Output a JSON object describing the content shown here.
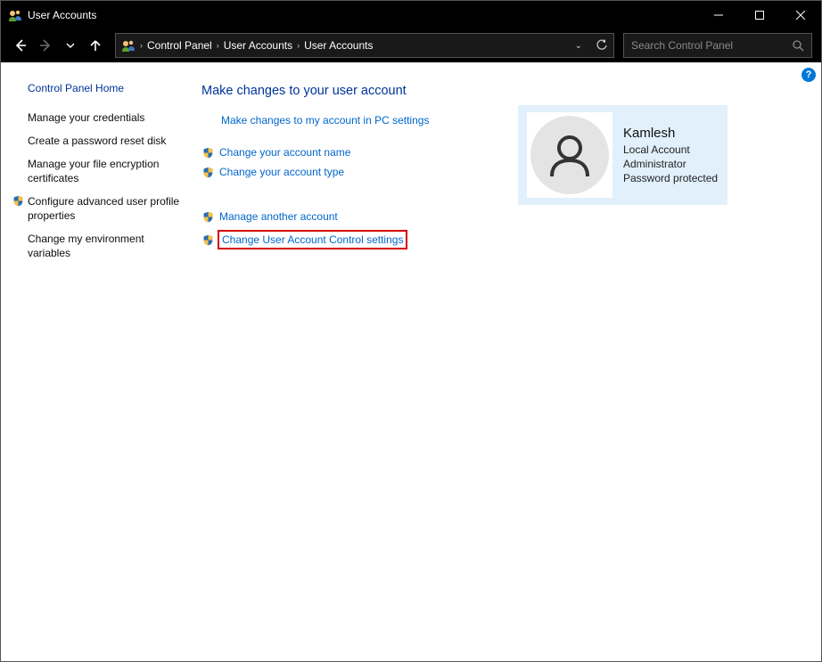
{
  "window": {
    "title": "User Accounts"
  },
  "breadcrumb": {
    "items": [
      "Control Panel",
      "User Accounts",
      "User Accounts"
    ]
  },
  "search": {
    "placeholder": "Search Control Panel"
  },
  "sidebar": {
    "home": "Control Panel Home",
    "items": [
      {
        "label": "Manage your credentials",
        "shield": false
      },
      {
        "label": "Create a password reset disk",
        "shield": false
      },
      {
        "label": "Manage your file encryption certificates",
        "shield": false
      },
      {
        "label": "Configure advanced user profile properties",
        "shield": true
      },
      {
        "label": "Change my environment variables",
        "shield": false
      }
    ]
  },
  "main": {
    "heading": "Make changes to your user account",
    "group1": [
      {
        "label": "Make changes to my account in PC settings",
        "shield": false,
        "indent": true
      },
      {
        "label": "Change your account name",
        "shield": true
      },
      {
        "label": "Change your account type",
        "shield": true
      }
    ],
    "group2": [
      {
        "label": "Manage another account",
        "shield": true,
        "highlight": false
      },
      {
        "label": "Change User Account Control settings",
        "shield": true,
        "highlight": true
      }
    ]
  },
  "user": {
    "name": "Kamlesh",
    "lines": [
      "Local Account",
      "Administrator",
      "Password protected"
    ]
  }
}
